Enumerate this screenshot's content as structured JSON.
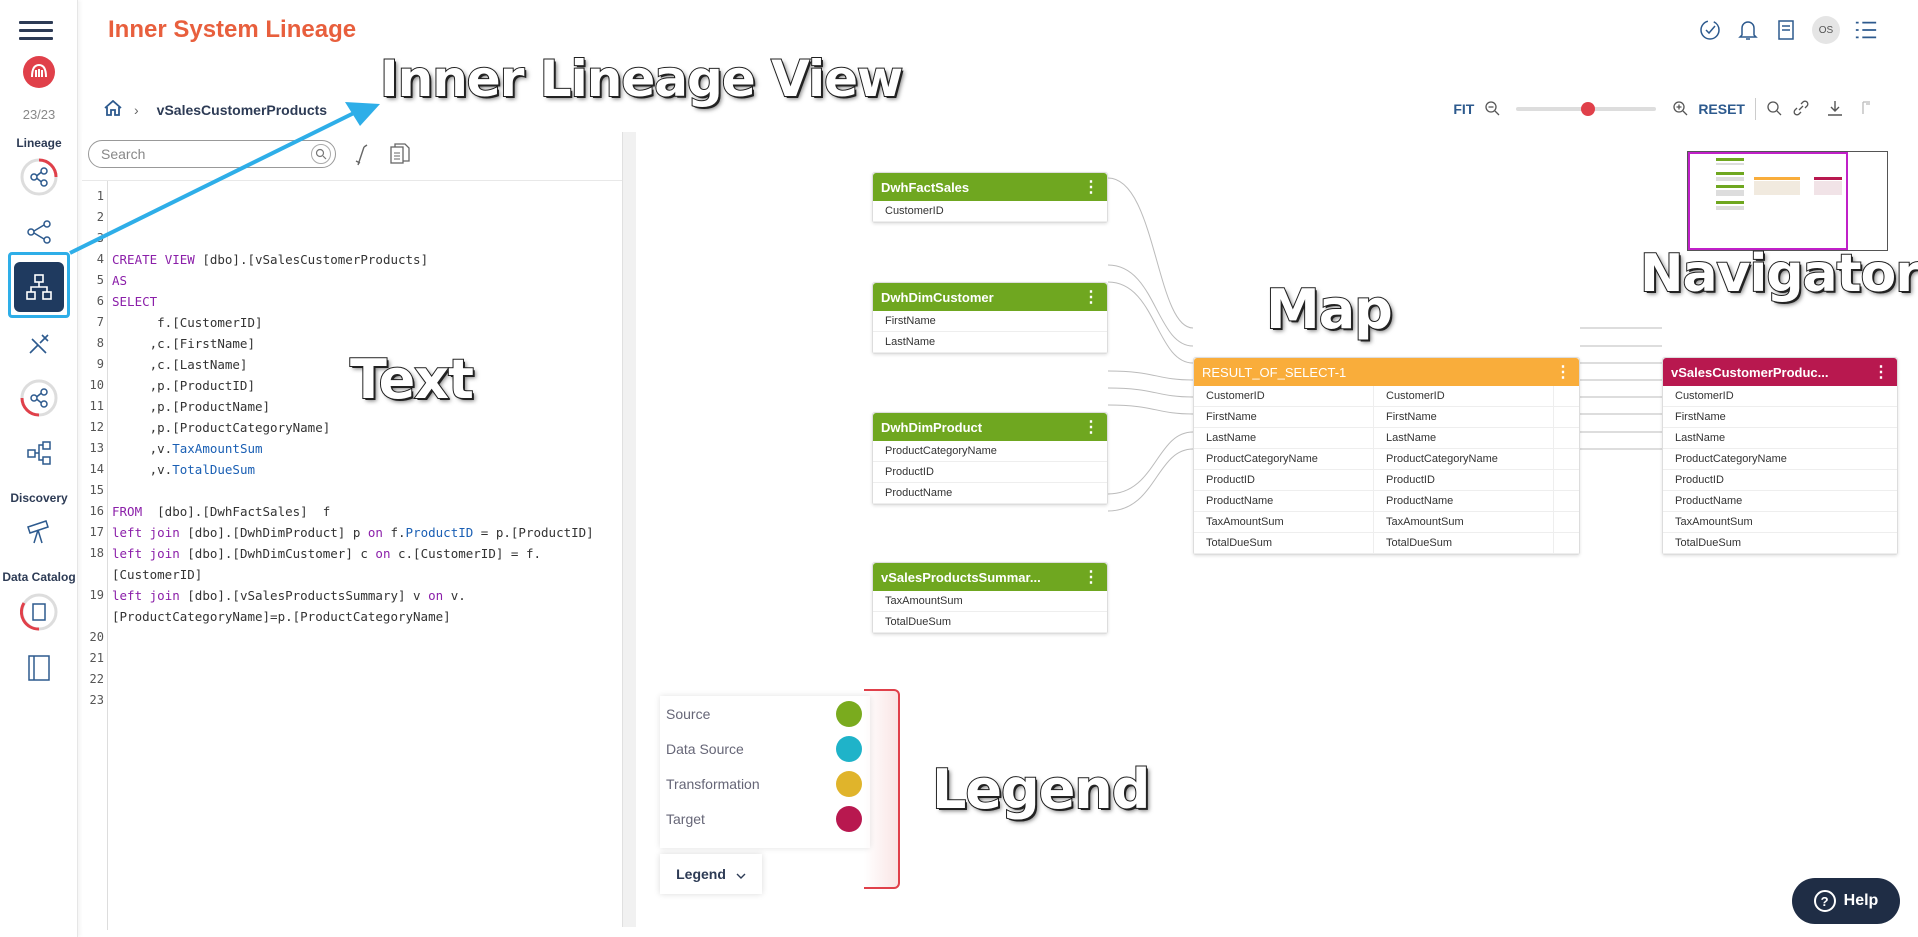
{
  "app": {
    "title": "Inner System Lineage"
  },
  "rail": {
    "counter": "23/23",
    "sections": {
      "lineage": "Lineage",
      "discovery": "Discovery",
      "data_catalog": "Data Catalog"
    },
    "icons": [
      "menu-icon",
      "logo-icon",
      "lineage-graph-icon",
      "tree-icon",
      "inner-lineage-icon",
      "tools-icon",
      "cross-system-icon",
      "structure-icon",
      "telescope-icon",
      "catalog-icon",
      "book-icon"
    ]
  },
  "header": {
    "avatar": "OS"
  },
  "breadcrumb": {
    "current": "vSalesCustomerProducts"
  },
  "zoom": {
    "fit": "FIT",
    "reset": "RESET",
    "level": 0.55
  },
  "text_pane": {
    "search_placeholder": "Search",
    "line_numbers": [
      "1",
      "2",
      "3",
      "4",
      "5",
      "6",
      "7",
      "8",
      "9",
      "10",
      "11",
      "12",
      "13",
      "14",
      "15",
      "16",
      "17",
      "18",
      "",
      "19",
      "",
      "20",
      "21",
      "22",
      "23"
    ],
    "lines": [
      "",
      "",
      "",
      "CREATE VIEW [dbo].[vSalesCustomerProducts]",
      "AS",
      "SELECT",
      "      f.[CustomerID]",
      "     ,c.[FirstName]",
      "     ,c.[LastName]",
      "     ,p.[ProductID]",
      "     ,p.[ProductName]",
      "     ,p.[ProductCategoryName]",
      "     ,v.TaxAmountSum",
      "     ,v.TotalDueSum",
      "",
      "FROM  [dbo].[DwhFactSales]  f",
      "left join [dbo].[DwhDimProduct] p on f.ProductID = p.[ProductID]",
      "left join [dbo].[DwhDimCustomer] c on c.[CustomerID] = f.",
      "[CustomerID]",
      "left join [dbo].[vSalesProductsSummary] v on v.",
      "[ProductCategoryName]=p.[ProductCategoryName]",
      "",
      "",
      "",
      ""
    ]
  },
  "map": {
    "sources": [
      {
        "name": "DwhFactSales",
        "fields": [
          "CustomerID"
        ]
      },
      {
        "name": "DwhDimCustomer",
        "fields": [
          "FirstName",
          "LastName"
        ]
      },
      {
        "name": "DwhDimProduct",
        "fields": [
          "ProductCategoryName",
          "ProductID",
          "ProductName"
        ]
      },
      {
        "name": "vSalesProductsSummar...",
        "fields": [
          "TaxAmountSum",
          "TotalDueSum"
        ]
      }
    ],
    "transformation": {
      "name": "RESULT_OF_SELECT-1",
      "rows": [
        [
          "CustomerID",
          "CustomerID"
        ],
        [
          "FirstName",
          "FirstName"
        ],
        [
          "LastName",
          "LastName"
        ],
        [
          "ProductCategoryName",
          "ProductCategoryName"
        ],
        [
          "ProductID",
          "ProductID"
        ],
        [
          "ProductName",
          "ProductName"
        ],
        [
          "TaxAmountSum",
          "TaxAmountSum"
        ],
        [
          "TotalDueSum",
          "TotalDueSum"
        ]
      ]
    },
    "target": {
      "name": "vSalesCustomerProduc...",
      "fields": [
        "CustomerID",
        "FirstName",
        "LastName",
        "ProductCategoryName",
        "ProductID",
        "ProductName",
        "TaxAmountSum",
        "TotalDueSum"
      ]
    }
  },
  "legend": {
    "items": [
      {
        "label": "Source",
        "color": "#7aab1e"
      },
      {
        "label": "Data Source",
        "color": "#1fb3c9"
      },
      {
        "label": "Transformation",
        "color": "#e0b42b"
      },
      {
        "label": "Target",
        "color": "#b8184f"
      }
    ],
    "button": "Legend"
  },
  "help": {
    "label": "Help"
  },
  "annotations": {
    "inner_lineage": "Inner Lineage View",
    "text": "Text",
    "map": "Map",
    "navigator": "Navigator",
    "legend": "Legend"
  },
  "colors": {
    "title": "#e85f3d",
    "source": "#6fa720",
    "transformation": "#f9ad3b",
    "target": "#b8184f",
    "nav_dark": "#1f3a5f"
  }
}
